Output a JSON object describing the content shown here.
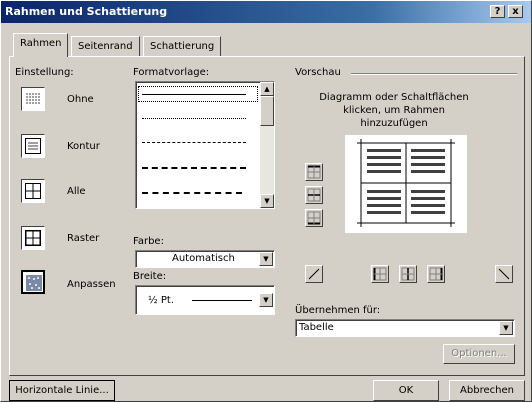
{
  "window": {
    "title": "Rahmen und Schattierung",
    "help_label": "?",
    "close_label": "x"
  },
  "tabs": [
    {
      "label": "Rahmen",
      "active": true
    },
    {
      "label": "Seitenrand",
      "active": false
    },
    {
      "label": "Schattierung",
      "active": false
    }
  ],
  "settings": {
    "heading": "Einstellung:",
    "items": [
      {
        "label": "Ohne",
        "icon": "none-border-icon"
      },
      {
        "label": "Kontur",
        "icon": "box-border-icon"
      },
      {
        "label": "Alle",
        "icon": "all-borders-icon"
      },
      {
        "label": "Raster",
        "icon": "grid-border-icon"
      },
      {
        "label": "Anpassen",
        "icon": "custom-border-icon"
      }
    ]
  },
  "style": {
    "heading": "Formatvorlage:",
    "color_label": "Farbe:",
    "color_value": "Automatisch",
    "width_label": "Breite:",
    "width_value": "½ Pt."
  },
  "preview": {
    "heading": "Vorschau",
    "hint": "Diagramm oder Schaltflächen klicken, um Rahmen hinzuzufügen"
  },
  "apply": {
    "label": "Übernehmen für:",
    "value": "Tabelle"
  },
  "buttons": {
    "options": "Optionen...",
    "horizontal_line": "Horizontale Linie...",
    "ok": "OK",
    "cancel": "Abbrechen"
  },
  "colors": {
    "title_start": "#0a246a",
    "title_end": "#a6caf0",
    "dialog_bg": "#d4d0c8",
    "selection": "#0a246a"
  }
}
